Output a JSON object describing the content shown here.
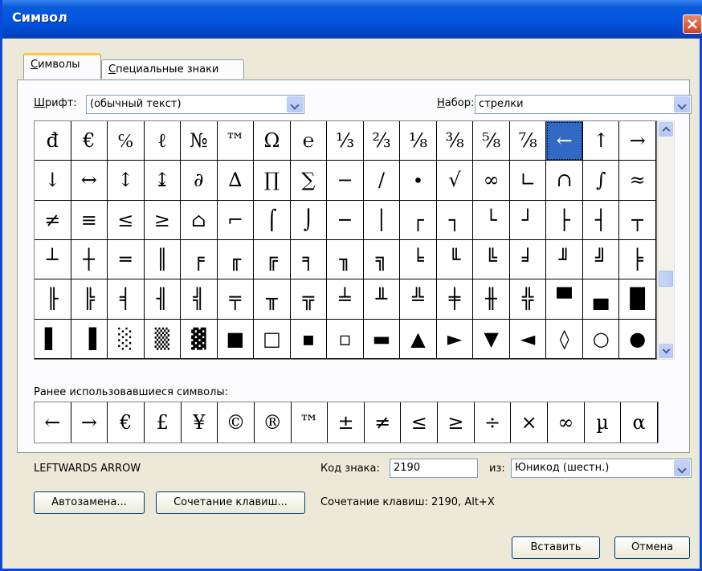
{
  "window": {
    "title": "Символ"
  },
  "tabs": [
    {
      "label_u": "С",
      "label_rest": "имволы"
    },
    {
      "label_u": "С",
      "label_rest": "пециальные знаки",
      "label_pre": ""
    }
  ],
  "font": {
    "label_u": "Ш",
    "label_rest": "рифт:",
    "value": "(обычный текст)"
  },
  "subset": {
    "label_u": "Н",
    "label_rest": "абор:",
    "value": "стрелки"
  },
  "symbols": [
    [
      "đ",
      "€",
      "℅",
      "ℓ",
      "№",
      "™",
      "Ω",
      "℮",
      "⅓",
      "⅔",
      "⅛",
      "⅜",
      "⅝",
      "⅞",
      "←",
      "↑",
      "→"
    ],
    [
      "↓",
      "↔",
      "↕",
      "↨",
      "∂",
      "∆",
      "∏",
      "∑",
      "−",
      "∕",
      "∙",
      "√",
      "∞",
      "∟",
      "∩",
      "∫",
      "≈"
    ],
    [
      "≠",
      "≡",
      "≤",
      "≥",
      "⌂",
      "⌐",
      "⌠",
      "⌡",
      "─",
      "│",
      "┌",
      "┐",
      "└",
      "┘",
      "├",
      "┤",
      "┬"
    ],
    [
      "┴",
      "┼",
      "═",
      "║",
      "╒",
      "╓",
      "╔",
      "╕",
      "╖",
      "╗",
      "╘",
      "╙",
      "╚",
      "╛",
      "╜",
      "╝",
      "╞"
    ],
    [
      "╟",
      "╠",
      "╡",
      "╢",
      "╣",
      "╤",
      "╥",
      "╦",
      "╧",
      "╨",
      "╩",
      "╪",
      "╫",
      "╬",
      "▀",
      "▄",
      "█"
    ],
    [
      "▌",
      "▐",
      "░",
      "▒",
      "▓",
      "■",
      "□",
      "▪",
      "▫",
      "▬",
      "▲",
      "►",
      "▼",
      "◄",
      "◊",
      "○",
      "●"
    ]
  ],
  "selected": {
    "row": 0,
    "col": 14
  },
  "recent": {
    "label": "Ранее использовавшиеся символы:",
    "label_u_index": 0,
    "symbols": [
      "←",
      "→",
      "€",
      "£",
      "¥",
      "©",
      "®",
      "™",
      "±",
      "≠",
      "≤",
      "≥",
      "÷",
      "×",
      "∞",
      "µ",
      "α"
    ]
  },
  "char_name": "LEFTWARDS ARROW",
  "code": {
    "label": "Код знака:",
    "value": "2190"
  },
  "from": {
    "label": "из:",
    "value": "Юникод (шестн.)"
  },
  "buttons": {
    "autocorrect": "Автозамена...",
    "shortcut": "Сочетание клавиш...",
    "insert": "Вставить",
    "cancel": "Отмена"
  },
  "shortcut_info": "Сочетание клавиш: 2190, Alt+X",
  "colors": {
    "selection": "#316ac5",
    "titlebar": "#0254e0"
  }
}
